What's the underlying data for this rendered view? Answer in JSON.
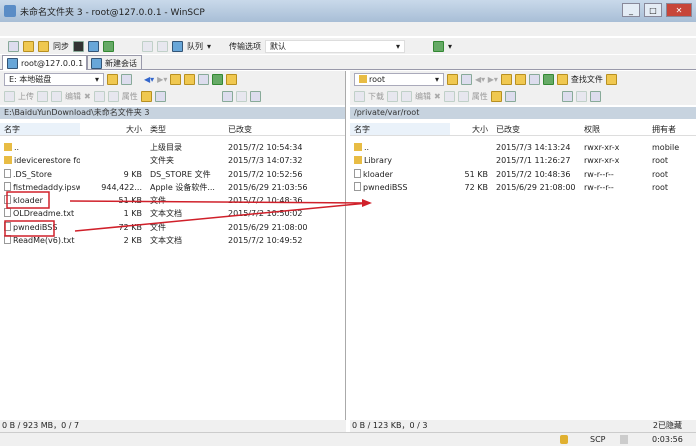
{
  "window": {
    "title": "未命名文件夹 3 - root@127.0.0.1 - WinSCP"
  },
  "toolbar": {
    "sync": "同步",
    "queue": "队列",
    "transfer_label": "传输选项",
    "transfer_value": "默认"
  },
  "tabs": [
    {
      "label": "root@127.0.0.1"
    },
    {
      "label": "新建会话"
    }
  ],
  "left": {
    "drive": "E: 本地磁盘",
    "upload": "上传",
    "edit": "编辑",
    "props": "属性",
    "path": "E:\\BaiduYunDownload\\未命名文件夹 3",
    "columns": [
      "名字",
      "大小",
      "类型",
      "已改变"
    ],
    "rows": [
      {
        "name": "..",
        "size": "",
        "type": "上级目录",
        "modified": "2015/7/2  10:54:34",
        "kind": "folder"
      },
      {
        "name": "idevicerestore for ...",
        "size": "",
        "type": "文件夹",
        "modified": "2015/7/3  14:07:32",
        "kind": "folder"
      },
      {
        "name": ".DS_Store",
        "size": "9 KB",
        "type": "DS_STORE 文件",
        "modified": "2015/7/2  10:52:56",
        "kind": "file"
      },
      {
        "name": "fistmedaddy.ipsw",
        "size": "944,422...",
        "type": "Apple 设备软件...",
        "modified": "2015/6/29  21:03:56",
        "kind": "file"
      },
      {
        "name": "kloader",
        "size": "51 KB",
        "type": "文件",
        "modified": "2015/7/2  10:48:36",
        "kind": "file"
      },
      {
        "name": "OLDreadme.txt",
        "size": "1 KB",
        "type": "文本文档",
        "modified": "2015/7/2  10:50:02",
        "kind": "file"
      },
      {
        "name": "pwnediBSS",
        "size": "72 KB",
        "type": "文件",
        "modified": "2015/6/29  21:08:00",
        "kind": "file"
      },
      {
        "name": "ReadMe(v6).txt",
        "size": "2 KB",
        "type": "文本文档",
        "modified": "2015/7/2  10:49:52",
        "kind": "file"
      }
    ],
    "status": "0 B / 923 MB，0 / 7"
  },
  "right": {
    "dir": "root",
    "find": "查找文件",
    "download": "下载",
    "edit": "编辑",
    "props": "属性",
    "path": "/private/var/root",
    "columns": [
      "名字",
      "大小",
      "已改变",
      "权限",
      "拥有者"
    ],
    "rows": [
      {
        "name": "..",
        "size": "",
        "modified": "2015/7/3 14:13:24",
        "rights": "rwxr-xr-x",
        "owner": "mobile",
        "kind": "folder"
      },
      {
        "name": "Library",
        "size": "",
        "modified": "2015/7/1 11:26:27",
        "rights": "rwxr-xr-x",
        "owner": "root",
        "kind": "folder"
      },
      {
        "name": "kloader",
        "size": "51 KB",
        "modified": "2015/7/2 10:48:36",
        "rights": "rw-r--r--",
        "owner": "root",
        "kind": "file"
      },
      {
        "name": "pwnediBSS",
        "size": "72 KB",
        "modified": "2015/6/29 21:08:00",
        "rights": "rw-r--r--",
        "owner": "root",
        "kind": "file"
      }
    ],
    "status": "0 B / 123 KB，0 / 3",
    "hidden": "2已隐藏"
  },
  "bottom": {
    "protocol": "SCP",
    "elapsed": "0:03:56"
  },
  "annotation_color": "#d0202a"
}
